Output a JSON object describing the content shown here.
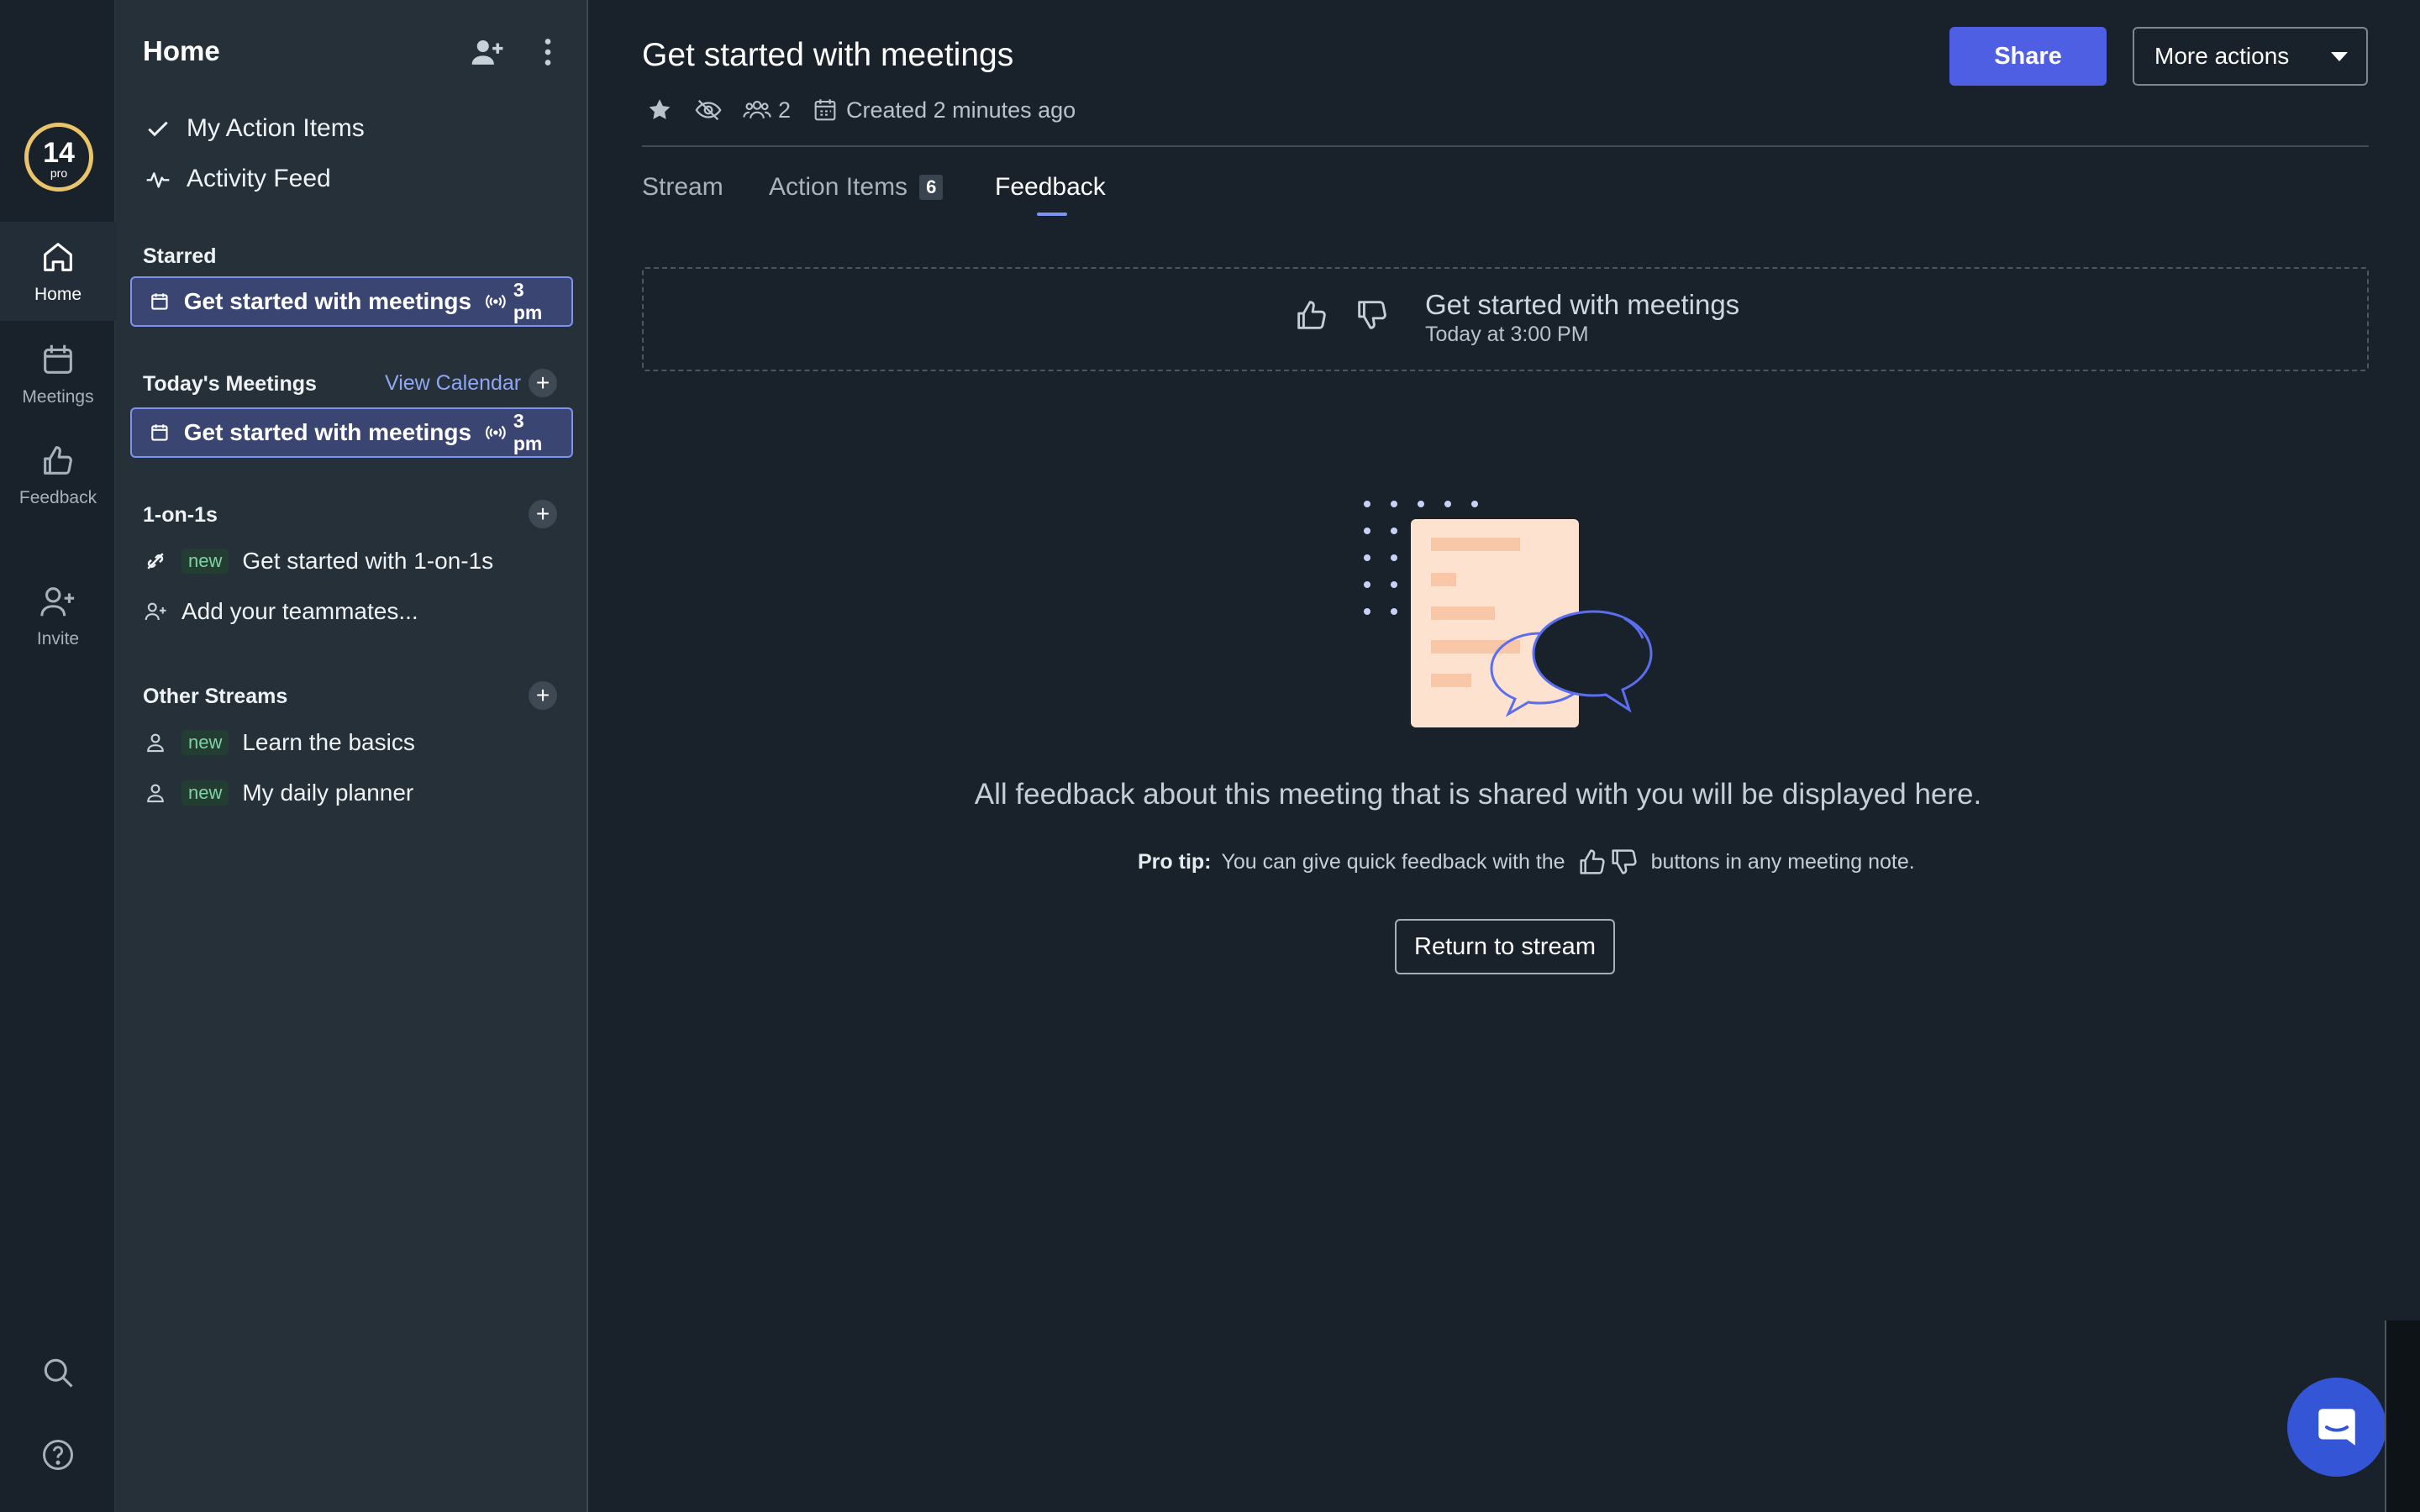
{
  "rail": {
    "badge_number": "14",
    "badge_sub": "pro",
    "items": [
      {
        "label": "Home",
        "icon": "home-icon"
      },
      {
        "label": "Meetings",
        "icon": "calendar-icon"
      },
      {
        "label": "Feedback",
        "icon": "thumbs-up-icon"
      },
      {
        "label": "Invite",
        "icon": "user-plus-icon"
      }
    ],
    "bottom_icons": [
      "search-icon",
      "help-icon"
    ]
  },
  "sidebar": {
    "title": "Home",
    "links": [
      {
        "label": "My Action Items",
        "icon": "check-icon"
      },
      {
        "label": "Activity Feed",
        "icon": "activity-icon"
      }
    ],
    "starred": {
      "heading": "Starred",
      "items": [
        {
          "label": "Get started with meetings",
          "time": "3 pm"
        }
      ]
    },
    "today": {
      "heading": "Today's Meetings",
      "view_calendar": "View Calendar",
      "items": [
        {
          "label": "Get started with meetings",
          "time": "3 pm"
        }
      ]
    },
    "one_on_ones": {
      "heading": "1-on-1s",
      "items": [
        {
          "tag": "new",
          "label": "Get started with 1-on-1s"
        },
        {
          "tag": "",
          "label": "Add your teammates..."
        }
      ]
    },
    "other_streams": {
      "heading": "Other Streams",
      "items": [
        {
          "tag": "new",
          "label": "Learn the basics"
        },
        {
          "tag": "new",
          "label": "My daily planner"
        }
      ]
    }
  },
  "main": {
    "title": "Get started with meetings",
    "attendee_count": "2",
    "created": "Created 2 minutes ago",
    "share_label": "Share",
    "more_actions_label": "More actions",
    "tabs": [
      {
        "label": "Stream"
      },
      {
        "label": "Action Items",
        "count": "6"
      },
      {
        "label": "Feedback"
      }
    ],
    "active_tab": "Feedback",
    "feedback_card": {
      "title": "Get started with meetings",
      "subtitle": "Today at 3:00 PM"
    },
    "empty_message": "All feedback about this meeting that is shared with you will be displayed here.",
    "pro_tip_label": "Pro tip:",
    "pro_tip_before": "You can give quick feedback with the",
    "pro_tip_after": "buttons in any meeting note.",
    "return_label": "Return to stream"
  },
  "colors": {
    "background": "#19212a",
    "sidebar": "#263039",
    "accent": "#4f5fe3",
    "highlight_border": "#7d93f2",
    "badge_ring": "#e9c46a",
    "new_tag": "#7fd3a3"
  }
}
